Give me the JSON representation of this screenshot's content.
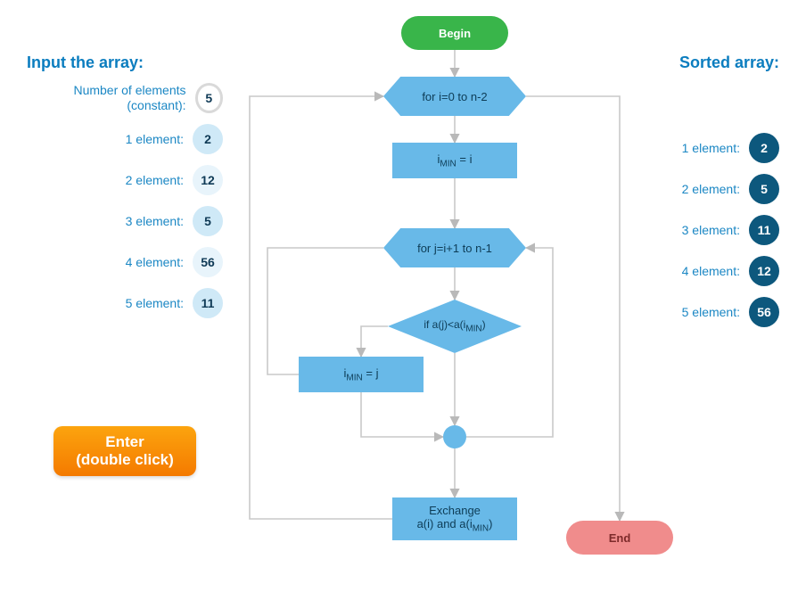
{
  "input": {
    "title": "Input the array:",
    "constant_label": "Number of elements (constant):",
    "constant_value": "5",
    "rows": [
      {
        "label": "1 element:",
        "value": "2"
      },
      {
        "label": "2 element:",
        "value": "12"
      },
      {
        "label": "3 element:",
        "value": "5"
      },
      {
        "label": "4 element:",
        "value": "56"
      },
      {
        "label": "5 element:",
        "value": "11"
      }
    ]
  },
  "output": {
    "title": "Sorted array:",
    "rows": [
      {
        "label": "1 element:",
        "value": "2"
      },
      {
        "label": "2 element:",
        "value": "5"
      },
      {
        "label": "3 element:",
        "value": "11"
      },
      {
        "label": "4 element:",
        "value": "12"
      },
      {
        "label": "5 element:",
        "value": "56"
      }
    ]
  },
  "button": {
    "line1": "Enter",
    "line2": "(double click)"
  },
  "flow": {
    "begin": "Begin",
    "loop1": "for i=0 to n-2",
    "imin_i_pre": "i",
    "imin_i_sub": "MIN",
    "imin_i_post": " = i",
    "loop2": "for j=i+1 to n-1",
    "decision_pre": "if a(j)<a(i",
    "decision_sub": "MIN",
    "decision_post": ")",
    "imin_j_pre": "i",
    "imin_j_sub": "MIN",
    "imin_j_post": " = j",
    "exchange_line1": "Exchange",
    "exchange_line2_pre": "a(i) and a(i",
    "exchange_line2_sub": "MIN",
    "exchange_line2_post": ")",
    "end": "End"
  }
}
